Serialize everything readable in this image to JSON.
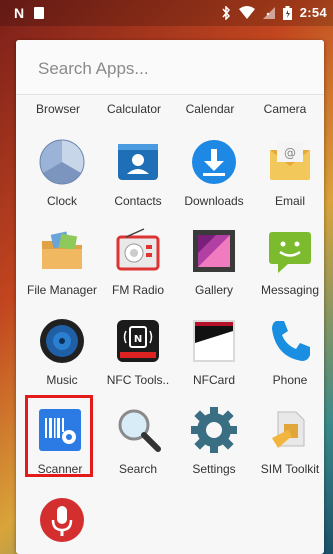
{
  "status_bar": {
    "left_icons": [
      "n-icon",
      "sd-card-icon"
    ],
    "right_icons": [
      "bluetooth-icon",
      "wifi-icon",
      "signal-icon",
      "battery-icon"
    ],
    "time": "2:54",
    "left_glyph": "N"
  },
  "search": {
    "placeholder": "Search Apps..."
  },
  "partial_row": [
    "Browser",
    "Calculator",
    "Calendar",
    "Camera"
  ],
  "apps": [
    {
      "label": "Clock",
      "icon": "clock-icon"
    },
    {
      "label": "Contacts",
      "icon": "contacts-icon"
    },
    {
      "label": "Downloads",
      "icon": "downloads-icon"
    },
    {
      "label": "Email",
      "icon": "email-icon"
    },
    {
      "label": "File Manager",
      "icon": "file-manager-icon"
    },
    {
      "label": "FM Radio",
      "icon": "fm-radio-icon"
    },
    {
      "label": "Gallery",
      "icon": "gallery-icon"
    },
    {
      "label": "Messaging",
      "icon": "messaging-icon"
    },
    {
      "label": "Music",
      "icon": "music-icon"
    },
    {
      "label": "NFC Tools..",
      "icon": "nfc-tools-icon"
    },
    {
      "label": "NFCard",
      "icon": "nfcard-icon"
    },
    {
      "label": "Phone",
      "icon": "phone-icon"
    },
    {
      "label": "Scanner",
      "icon": "scanner-icon"
    },
    {
      "label": "Search",
      "icon": "search-icon"
    },
    {
      "label": "Settings",
      "icon": "settings-icon"
    },
    {
      "label": "SIM Toolkit",
      "icon": "sim-toolkit-icon"
    }
  ],
  "partial_bottom": [
    {
      "icon": "sound-recorder-icon"
    }
  ],
  "highlight_color": "#e31b1b"
}
